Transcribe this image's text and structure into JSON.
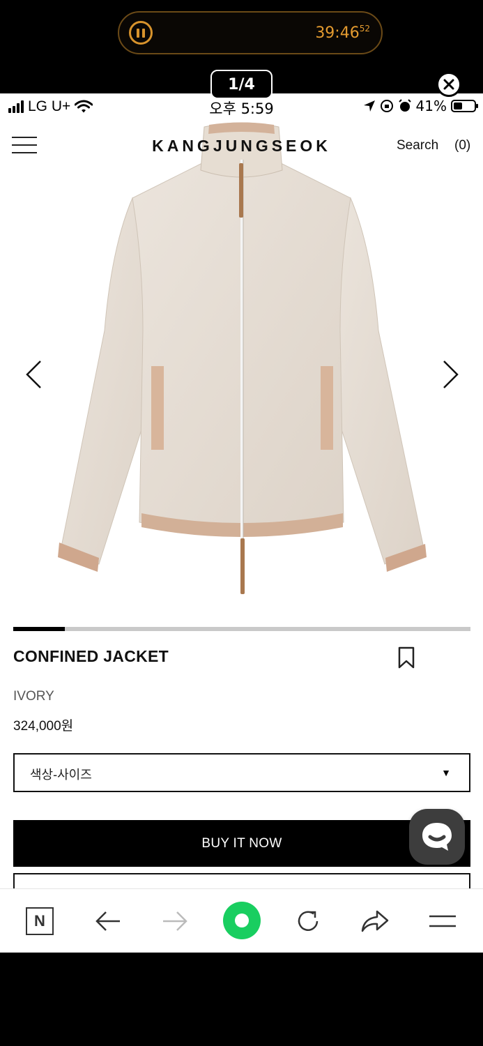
{
  "overlay": {
    "timer_main": "39:46",
    "timer_sub": "52",
    "page_counter": "1/4"
  },
  "status_bar": {
    "carrier": "LG U+",
    "time": "오후 5:59",
    "battery": "41%"
  },
  "header": {
    "logo": "KANGJUNGSEOK",
    "search_label": "Search",
    "cart_count": "(0)"
  },
  "gallery": {
    "current_index": 1,
    "total": 4
  },
  "product": {
    "title": "CONFINED JACKET",
    "color": "IVORY",
    "price": "324,000원",
    "option_placeholder": "색상-사이즈",
    "buy_label": "BUY IT NOW"
  },
  "colors": {
    "timer_accent": "#e39a2f",
    "browser_green": "#19ce60"
  },
  "browser_nav": {
    "icons": [
      "naver-n-icon",
      "back-arrow-icon",
      "forward-arrow-icon",
      "green-home-icon",
      "refresh-icon",
      "share-icon",
      "menu-icon"
    ]
  }
}
